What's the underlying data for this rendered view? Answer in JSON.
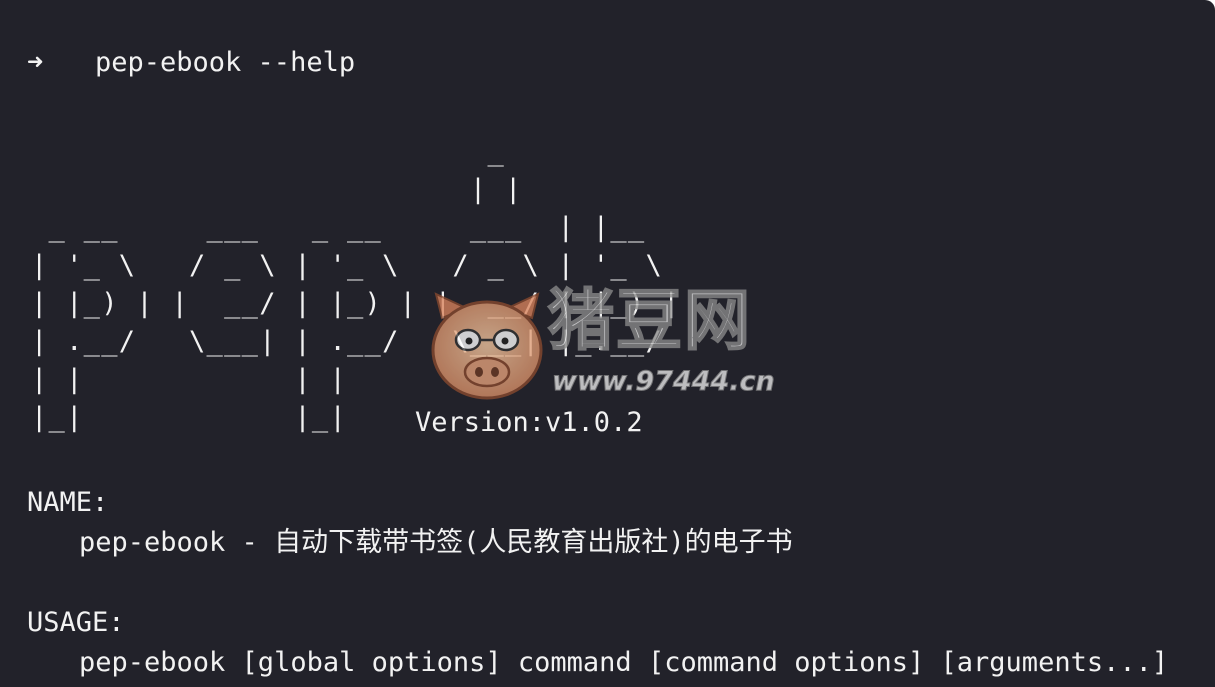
{
  "terminal": {
    "background": "#22222a",
    "foreground": "#f2f2f2"
  },
  "prompt": {
    "symbol": "➜",
    "command": "pep-ebook --help"
  },
  "banner": {
    "ascii_art": "                          _\n                         | |\n _ __     ___   _ __     ___  | |__\n| '_ \\   / _ \\ | '_ \\   / _ \\ | '_ \\\n| |_) | |  __/ | |_) | |  __/ | |_) |\n| .__/   \\___| | .__/   \\___| |_.__/\n| |            | |\n|_|            |_|",
    "version": "Version:v1.0.2"
  },
  "name_section": {
    "heading": "NAME:",
    "value": "pep-ebook - 自动下载带书签(人民教育出版社)的电子书"
  },
  "usage_section": {
    "heading": "USAGE:",
    "value": "pep-ebook [global options] command [command options] [arguments...]"
  },
  "watermark": {
    "brand": "猪豆网",
    "url": "www.97444.cn"
  }
}
